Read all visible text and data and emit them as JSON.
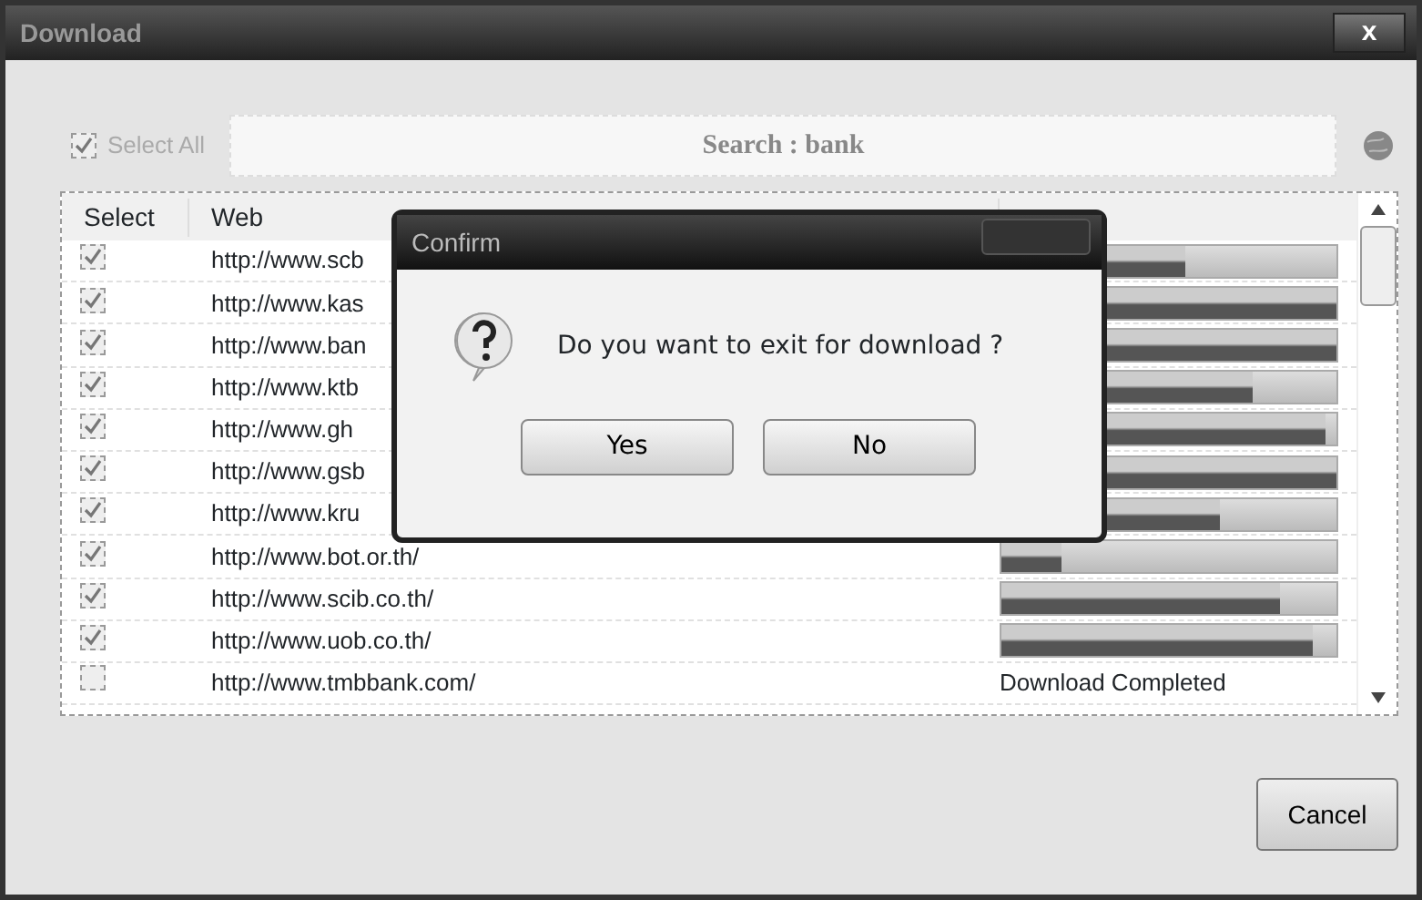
{
  "window": {
    "title": "Download",
    "close": "x"
  },
  "select_all": {
    "label": "Select All",
    "checked": true
  },
  "search": {
    "value": "Search : bank"
  },
  "table": {
    "columns": [
      "Select",
      "Web"
    ],
    "rows": [
      {
        "checked": true,
        "web": "http://www.scb",
        "level": 0.55
      },
      {
        "checked": true,
        "web": "http://www.kas",
        "level": 1.0
      },
      {
        "checked": true,
        "web": "http://www.ban",
        "level": 1.0
      },
      {
        "checked": true,
        "web": "http://www.ktb",
        "level": 0.75
      },
      {
        "checked": true,
        "web": "http://www.gh",
        "level": 0.97
      },
      {
        "checked": true,
        "web": "http://www.gsb",
        "level": 1.0
      },
      {
        "checked": true,
        "web": "http://www.kru",
        "level": 0.65
      },
      {
        "checked": true,
        "web": "http://www.bot.or.th/",
        "level": 0.18
      },
      {
        "checked": true,
        "web": "http://www.scib.co.th/",
        "level": 0.83
      },
      {
        "checked": true,
        "web": "http://www.uob.co.th/",
        "level": 0.93
      },
      {
        "checked": false,
        "web": "http://www.tmbbank.com/",
        "status": "Download Completed"
      }
    ]
  },
  "dialog": {
    "title": "Confirm",
    "message": "Do you want to exit for download ?",
    "buttons": [
      "Yes",
      "No"
    ]
  },
  "buttons": [
    "Cancel"
  ]
}
